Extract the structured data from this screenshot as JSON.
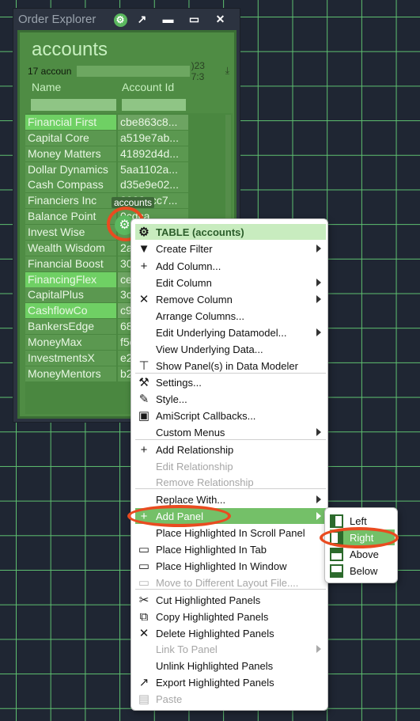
{
  "window": {
    "title": "Order Explorer",
    "controls": {
      "gear": "⚙",
      "popout": "↗",
      "minimize": "▬",
      "maximize": "▭",
      "close": "✕"
    }
  },
  "panel": {
    "title": "accounts",
    "row_count_label": "17 accoun",
    "timestamp_fragment": ")23 7:3",
    "download_icon": "⤓",
    "columns": [
      "Name",
      "Account Id"
    ],
    "rows": [
      {
        "name": "Financial First",
        "id": "cbe863c8...",
        "selected": true
      },
      {
        "name": "Capital Core",
        "id": "a519e7ab...",
        "selected": false
      },
      {
        "name": "Money Matters",
        "id": "41892d4d...",
        "selected": false
      },
      {
        "name": "Dollar Dynamics",
        "id": "5aa1102a...",
        "selected": false
      },
      {
        "name": "Cash Compass",
        "id": "d35e9e02...",
        "selected": false
      },
      {
        "name": "Financiers Inc",
        "id": "2902ecc7...",
        "selected": false
      },
      {
        "name": "Balance Point",
        "id": "   0cdca...",
        "selected": false
      },
      {
        "name": "Invest Wise",
        "id": "",
        "selected": false
      },
      {
        "name": "Wealth Wisdom",
        "id": "2a",
        "selected": false
      },
      {
        "name": "Financial Boost",
        "id": "30",
        "selected": false
      },
      {
        "name": "FinancingFlex",
        "id": "ce",
        "selected": true
      },
      {
        "name": "CapitalPlus",
        "id": "3c",
        "selected": false
      },
      {
        "name": "CashflowCo",
        "id": "c9",
        "selected": true
      },
      {
        "name": "BankersEdge",
        "id": "68",
        "selected": false
      },
      {
        "name": "MoneyMax",
        "id": "f5e",
        "selected": false
      },
      {
        "name": "InvestmentsX",
        "id": "e2",
        "selected": false
      },
      {
        "name": "MoneyMentors",
        "id": "b2",
        "selected": false
      }
    ],
    "tooltip": "accounts",
    "gear_glyph": "⚙"
  },
  "context_menu": {
    "items": [
      {
        "label": "TABLE (accounts)",
        "icon": "⚙",
        "type": "header"
      },
      {
        "label": "Create Filter",
        "icon": "▼",
        "submenu": true
      },
      {
        "label": "Add Column...",
        "icon": "+"
      },
      {
        "label": "Edit Column",
        "icon": "",
        "submenu": true
      },
      {
        "label": "Remove Column",
        "icon": "✕",
        "submenu": true
      },
      {
        "label": "Arrange Columns...",
        "icon": ""
      },
      {
        "label": "Edit Underlying Datamodel...",
        "icon": "",
        "submenu": true
      },
      {
        "label": "View Underlying Data...",
        "icon": ""
      },
      {
        "label": "Show Panel(s) in Data Modeler",
        "icon": "⊤"
      },
      {
        "label": "Settings...",
        "icon": "⚒"
      },
      {
        "label": "Style...",
        "icon": "✎"
      },
      {
        "label": "AmiScript Callbacks...",
        "icon": "▣"
      },
      {
        "label": "Custom Menus",
        "icon": "",
        "submenu": true
      },
      {
        "label": "Add Relationship",
        "icon": "+"
      },
      {
        "label": "Edit Relationship",
        "icon": "",
        "disabled": true
      },
      {
        "label": "Remove Relationship",
        "icon": "",
        "disabled": true
      },
      {
        "label": "Replace With...",
        "icon": "",
        "submenu": true
      },
      {
        "label": "Add Panel",
        "icon": "+",
        "submenu": true,
        "active": true
      },
      {
        "label": "Place Highlighted In Scroll Panel",
        "icon": ""
      },
      {
        "label": "Place Highlighted In Tab",
        "icon": "▭"
      },
      {
        "label": "Place Highlighted In Window",
        "icon": "▭"
      },
      {
        "label": "Move to Different Layout File....",
        "icon": "▭",
        "disabled": true
      },
      {
        "label": "Cut Highlighted Panels",
        "icon": "✂"
      },
      {
        "label": "Copy Highlighted Panels",
        "icon": "⧉"
      },
      {
        "label": "Delete Highlighted Panels",
        "icon": "✕"
      },
      {
        "label": "Link To Panel",
        "icon": "",
        "submenu": true,
        "disabled": true
      },
      {
        "label": "Unlink Highlighted Panels",
        "icon": ""
      },
      {
        "label": "Export Highlighted Panels",
        "icon": "↗"
      },
      {
        "label": "Paste",
        "icon": "▤",
        "disabled": true
      }
    ]
  },
  "add_panel_submenu": {
    "items": [
      {
        "label": "Left",
        "active": false
      },
      {
        "label": "Right",
        "active": true
      },
      {
        "label": "Above",
        "active": false
      },
      {
        "label": "Below",
        "active": false
      }
    ]
  },
  "colors": {
    "accent": "#74c068",
    "highlight_ring": "#e94b20",
    "grid": "#5ec070",
    "background": "#1f2633"
  }
}
